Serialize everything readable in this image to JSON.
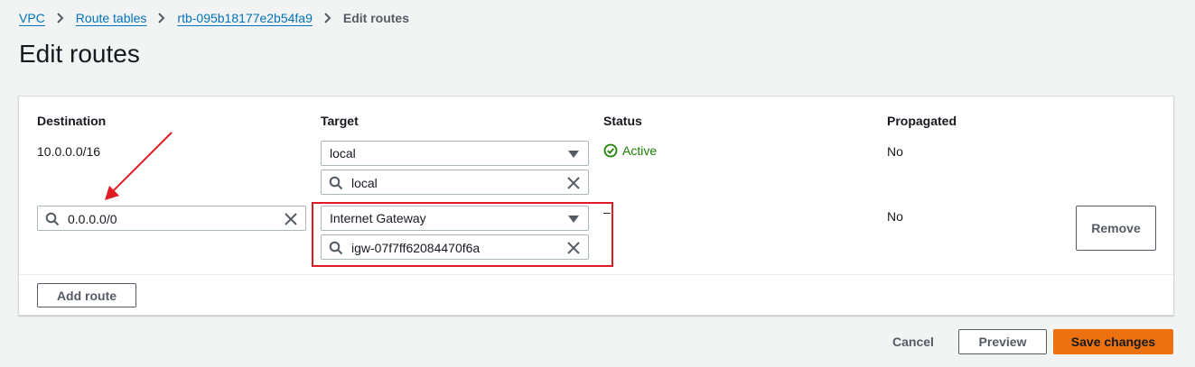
{
  "breadcrumb": {
    "items": [
      "VPC",
      "Route tables",
      "rtb-095b18177e2b54fa9"
    ],
    "current": "Edit routes"
  },
  "page_title": "Edit routes",
  "columns": {
    "destination": "Destination",
    "target": "Target",
    "status": "Status",
    "propagated": "Propagated"
  },
  "routes": [
    {
      "destination": "10.0.0.0/16",
      "target_type": "local",
      "target_value": "local",
      "status": "Active",
      "propagated": "No"
    },
    {
      "destination": "0.0.0.0/0",
      "target_type": "Internet Gateway",
      "target_value": "igw-07f7ff62084470f6a",
      "status": "–",
      "propagated": "No",
      "remove_label": "Remove"
    }
  ],
  "buttons": {
    "add_route": "Add route",
    "cancel": "Cancel",
    "preview": "Preview",
    "save": "Save changes"
  },
  "colors": {
    "link": "#0073bb",
    "status_active": "#1d8102",
    "primary": "#ec7211",
    "annotation": "#e01b24"
  }
}
